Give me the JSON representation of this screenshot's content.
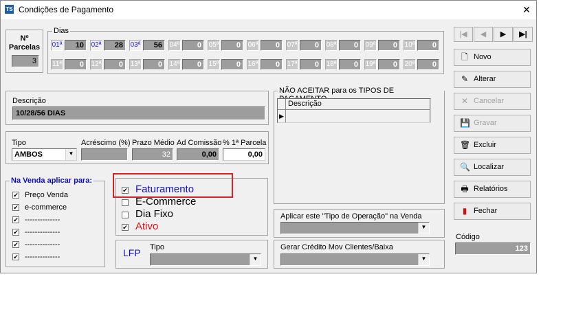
{
  "window": {
    "title": "Condições de Pagamento",
    "icon_text": "TS",
    "close_glyph": "✕"
  },
  "parcelas": {
    "label_line1": "Nº",
    "label_line2": "Parcelas",
    "value": "3"
  },
  "dias": {
    "label": "Dias",
    "items": [
      {
        "label": "01ª",
        "value": "10",
        "active": true
      },
      {
        "label": "02ª",
        "value": "28",
        "active": true
      },
      {
        "label": "03ª",
        "value": "56",
        "active": true
      },
      {
        "label": "04ª",
        "value": "0",
        "active": false
      },
      {
        "label": "05ª",
        "value": "0",
        "active": false
      },
      {
        "label": "06ª",
        "value": "0",
        "active": false
      },
      {
        "label": "07ª",
        "value": "0",
        "active": false
      },
      {
        "label": "08ª",
        "value": "0",
        "active": false
      },
      {
        "label": "09ª",
        "value": "0",
        "active": false
      },
      {
        "label": "10ª",
        "value": "0",
        "active": false
      },
      {
        "label": "11ª",
        "value": "0",
        "active": false
      },
      {
        "label": "12ª",
        "value": "0",
        "active": false
      },
      {
        "label": "13ª",
        "value": "0",
        "active": false
      },
      {
        "label": "14ª",
        "value": "0",
        "active": false
      },
      {
        "label": "15ª",
        "value": "0",
        "active": false
      },
      {
        "label": "16ª",
        "value": "0",
        "active": false
      },
      {
        "label": "17ª",
        "value": "0",
        "active": false
      },
      {
        "label": "18ª",
        "value": "0",
        "active": false
      },
      {
        "label": "19ª",
        "value": "0",
        "active": false
      },
      {
        "label": "20ª",
        "value": "0",
        "active": false
      }
    ]
  },
  "descricao": {
    "label": "Descrição",
    "value": "10/28/56 DIAS"
  },
  "tipo": {
    "label": "Tipo",
    "value": "AMBOS"
  },
  "acrescimo": {
    "label": "Acréscimo (%)",
    "value": ""
  },
  "prazo_medio": {
    "label": "Prazo Médio",
    "value": "32"
  },
  "ad_comissao": {
    "label": "Ad Comissão",
    "value": "0,00"
  },
  "primeira_parcela": {
    "label": "% 1ª Parcela",
    "value": "0,00"
  },
  "na_venda": {
    "label": "Na Venda aplicar para:",
    "items": [
      {
        "label": "Preço Venda",
        "checked": true
      },
      {
        "label": "e-commerce",
        "checked": true
      },
      {
        "label": "--------------",
        "checked": true
      },
      {
        "label": "--------------",
        "checked": true
      },
      {
        "label": "--------------",
        "checked": true
      },
      {
        "label": "--------------",
        "checked": true
      }
    ]
  },
  "flags": [
    {
      "label": "Faturamento",
      "checked": true,
      "color": "#1010c0"
    },
    {
      "label": "E-Commerce",
      "checked": false,
      "color": "#000000"
    },
    {
      "label": "Dia Fixo",
      "checked": false,
      "color": "#000000"
    },
    {
      "label": "Ativo",
      "checked": true,
      "color": "#e01010"
    }
  ],
  "lfp": {
    "label": "LFP",
    "tipo_label": "Tipo",
    "tipo_value": ""
  },
  "nao_aceitar": {
    "label": "NÃO ACEITAR para os TIPOS DE PAGAMENTO",
    "column": "Descrição"
  },
  "tipo_operacao": {
    "label": "Aplicar este \"Tipo de Operação\" na Venda",
    "value": ""
  },
  "gerar_credito": {
    "label": "Gerar Crédito Mov Clientes/Baixa",
    "value": ""
  },
  "nav": {
    "first": "|◀",
    "prev": "◀",
    "next": "▶",
    "last": "▶|"
  },
  "buttons": [
    {
      "label": "Novo",
      "icon": "new-doc-icon",
      "glyph": "🗋",
      "enabled": true
    },
    {
      "label": "Alterar",
      "icon": "edit-icon",
      "glyph": "✎",
      "enabled": true
    },
    {
      "label": "Cancelar",
      "icon": "cancel-icon",
      "glyph": "✕",
      "enabled": false
    },
    {
      "label": "Gravar",
      "icon": "save-icon",
      "glyph": "💾",
      "enabled": false
    },
    {
      "label": "Excluir",
      "icon": "trash-icon",
      "glyph": "🗑",
      "enabled": true
    },
    {
      "label": "Localizar",
      "icon": "search-icon",
      "glyph": "🔍",
      "enabled": true
    },
    {
      "label": "Relatórios",
      "icon": "print-icon",
      "glyph": "🖶",
      "enabled": true
    },
    {
      "label": "Fechar",
      "icon": "exit-icon",
      "glyph": "▮",
      "enabled": true
    }
  ],
  "codigo": {
    "label": "Código",
    "value": "123"
  },
  "colors": {
    "highlight": "#e02020",
    "active_day_label": "#1a1aff"
  }
}
